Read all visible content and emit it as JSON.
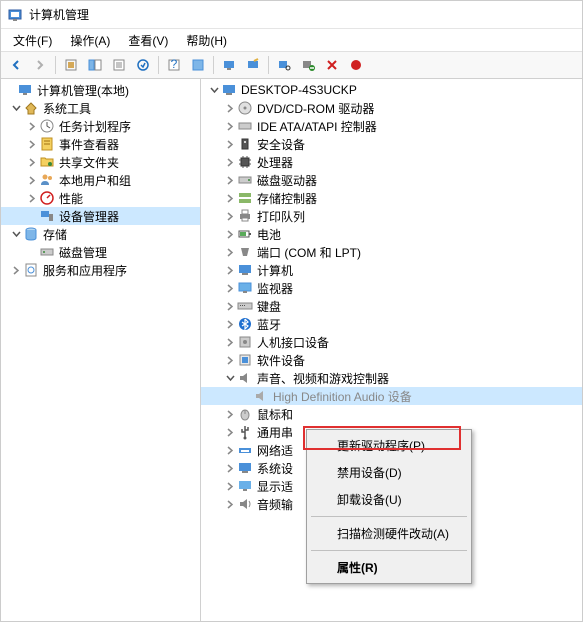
{
  "window": {
    "title": "计算机管理"
  },
  "menubar": {
    "file": "文件(F)",
    "action": "操作(A)",
    "view": "查看(V)",
    "help": "帮助(H)"
  },
  "left_tree": {
    "root": "计算机管理(本地)",
    "system_tools": "系统工具",
    "task_scheduler": "任务计划程序",
    "event_viewer": "事件查看器",
    "shared_folders": "共享文件夹",
    "local_users": "本地用户和组",
    "performance": "性能",
    "device_manager": "设备管理器",
    "storage": "存储",
    "disk_management": "磁盘管理",
    "services_apps": "服务和应用程序"
  },
  "right_tree": {
    "computer": "DESKTOP-4S3UCKP",
    "dvd": "DVD/CD-ROM 驱动器",
    "ide": "IDE ATA/ATAPI 控制器",
    "security": "安全设备",
    "processors": "处理器",
    "disk_drives": "磁盘驱动器",
    "storage_ctrl": "存储控制器",
    "print_queues": "打印队列",
    "batteries": "电池",
    "ports": "端口 (COM 和 LPT)",
    "computers": "计算机",
    "monitors": "监视器",
    "keyboards": "键盘",
    "bluetooth": "蓝牙",
    "hid": "人机接口设备",
    "software_dev": "软件设备",
    "audio_ctrl": "声音、视频和游戏控制器",
    "audio_device": "High Definition Audio 设备",
    "mouse": "鼠标和",
    "usb_serial": "通用串",
    "network": "网络适",
    "system_dev": "系统设",
    "display": "显示适",
    "audio_io": "音频输"
  },
  "context_menu": {
    "update_driver": "更新驱动程序(P)",
    "disable": "禁用设备(D)",
    "uninstall": "卸载设备(U)",
    "scan": "扫描检测硬件改动(A)",
    "properties": "属性(R)"
  }
}
